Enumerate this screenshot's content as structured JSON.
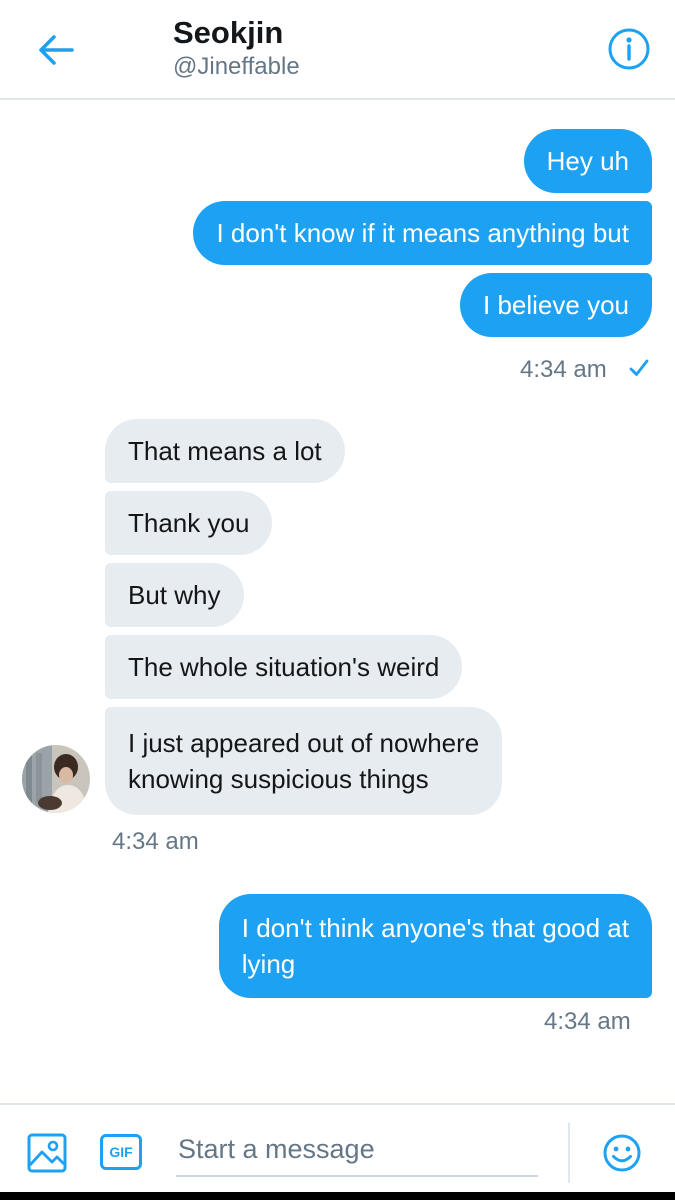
{
  "header": {
    "title": "Seokjin",
    "handle": "@Jineffable",
    "back_icon": "arrow-left-icon",
    "info_icon": "info-icon"
  },
  "messages": {
    "m1": "Hey uh",
    "m2": "I don't know if it means anything but",
    "m3": "I believe you",
    "t1": "4:34 am",
    "m4": "That means a lot",
    "m5": "Thank you",
    "m6": "But why",
    "m7": "The whole situation's weird",
    "m8_line1": "I just appeared out of nowhere",
    "m8_line2": "knowing suspicious things",
    "t2": "4:34 am",
    "m9_line1": "I don't think anyone's that good at",
    "m9_line2": "lying",
    "t3": "4:34 am"
  },
  "composer": {
    "placeholder": "Start a message",
    "gif_label": "GIF",
    "media_icon": "image-icon",
    "emoji_icon": "smiley-icon"
  },
  "colors": {
    "accent": "#1da1f2",
    "incoming_bubble": "#e6ecf0",
    "secondary_text": "#657786"
  }
}
